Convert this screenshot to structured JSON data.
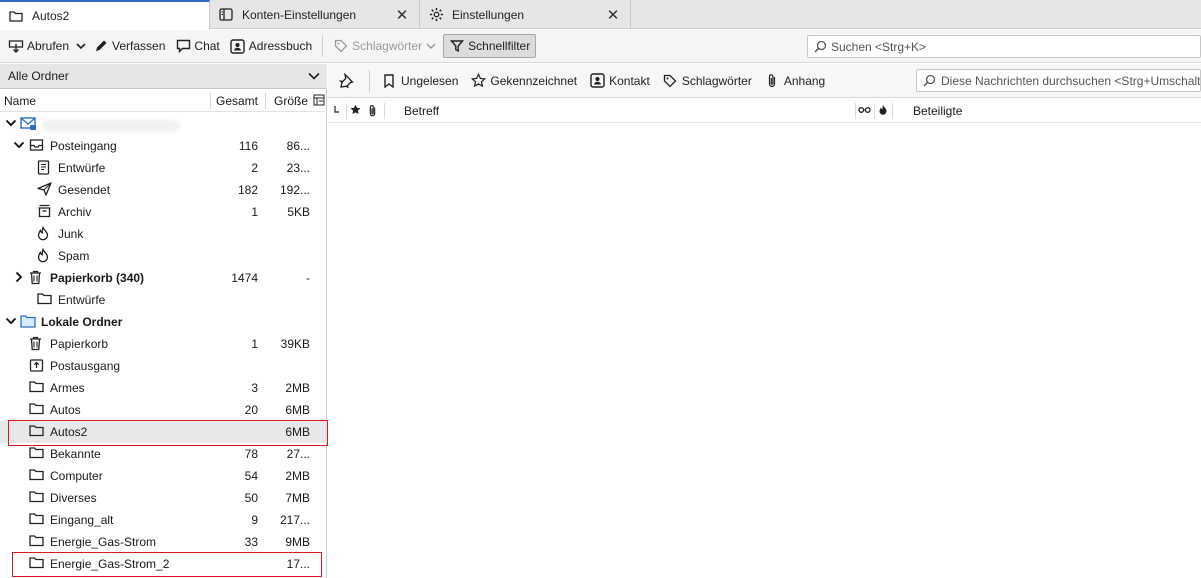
{
  "tabs": [
    {
      "label": "Autos2",
      "icon": "folder-icon",
      "active": true
    },
    {
      "label": "Konten-Einstellungen",
      "icon": "account-settings-icon",
      "active": false
    },
    {
      "label": "Einstellungen",
      "icon": "gear-icon",
      "active": false
    }
  ],
  "toolbar": {
    "abrufen": "Abrufen",
    "verfassen": "Verfassen",
    "chat": "Chat",
    "adressbuch": "Adressbuch",
    "schlagwoerter": "Schlagwörter",
    "schnellfilter": "Schnellfilter",
    "search_placeholder": "Suchen <Strg+K>"
  },
  "folder_pane": {
    "selector_label": "Alle Ordner",
    "columns": {
      "name": "Name",
      "total": "Gesamt",
      "size": "Größe"
    }
  },
  "folders": [
    {
      "name": "",
      "total": "",
      "size": "",
      "level": 0,
      "twisty": "open",
      "icon": "mail-account-icon",
      "bold": false
    },
    {
      "name": "Posteingang",
      "total": "116",
      "size": "86...",
      "level": 1,
      "twisty": "open",
      "icon": "inbox-icon",
      "bold": false
    },
    {
      "name": "Entwürfe",
      "total": "2",
      "size": "23...",
      "level": 2,
      "twisty": "",
      "icon": "drafts-icon",
      "bold": false
    },
    {
      "name": "Gesendet",
      "total": "182",
      "size": "192...",
      "level": 2,
      "twisty": "",
      "icon": "sent-icon",
      "bold": false
    },
    {
      "name": "Archiv",
      "total": "1",
      "size": "5KB",
      "level": 2,
      "twisty": "",
      "icon": "archive-icon",
      "bold": false
    },
    {
      "name": "Junk",
      "total": "",
      "size": "",
      "level": 2,
      "twisty": "",
      "icon": "junk-icon",
      "bold": false
    },
    {
      "name": "Spam",
      "total": "",
      "size": "",
      "level": 2,
      "twisty": "",
      "icon": "junk-icon",
      "bold": false
    },
    {
      "name": "Papierkorb (340)",
      "total": "1474",
      "size": "-",
      "level": 1,
      "twisty": "closed",
      "icon": "trash-icon",
      "bold": true
    },
    {
      "name": "Entwürfe",
      "total": "",
      "size": "",
      "level": 2,
      "twisty": "",
      "icon": "folder-icon",
      "bold": false
    },
    {
      "name": "Lokale Ordner",
      "total": "",
      "size": "",
      "level": 0,
      "twisty": "open",
      "icon": "local-folder-icon",
      "bold": true
    },
    {
      "name": "Papierkorb",
      "total": "1",
      "size": "39KB",
      "level": 1,
      "twisty": "",
      "icon": "trash-icon",
      "bold": false
    },
    {
      "name": "Postausgang",
      "total": "",
      "size": "",
      "level": 1,
      "twisty": "",
      "icon": "outbox-icon",
      "bold": false
    },
    {
      "name": "Armes",
      "total": "3",
      "size": "2MB",
      "level": 1,
      "twisty": "",
      "icon": "folder-icon",
      "bold": false
    },
    {
      "name": "Autos",
      "total": "20",
      "size": "6MB",
      "level": 1,
      "twisty": "",
      "icon": "folder-icon",
      "bold": false
    },
    {
      "name": "Autos2",
      "total": "",
      "size": "6MB",
      "level": 1,
      "twisty": "",
      "icon": "folder-icon",
      "bold": false,
      "selected": true
    },
    {
      "name": "Bekannte",
      "total": "78",
      "size": "27...",
      "level": 1,
      "twisty": "",
      "icon": "folder-icon",
      "bold": false
    },
    {
      "name": "Computer",
      "total": "54",
      "size": "2MB",
      "level": 1,
      "twisty": "",
      "icon": "folder-icon",
      "bold": false
    },
    {
      "name": "Diverses",
      "total": "50",
      "size": "7MB",
      "level": 1,
      "twisty": "",
      "icon": "folder-icon",
      "bold": false
    },
    {
      "name": "Eingang_alt",
      "total": "9",
      "size": "217...",
      "level": 1,
      "twisty": "",
      "icon": "folder-icon",
      "bold": false
    },
    {
      "name": "Energie_Gas-Strom",
      "total": "33",
      "size": "9MB",
      "level": 1,
      "twisty": "",
      "icon": "folder-icon",
      "bold": false
    },
    {
      "name": "Energie_Gas-Strom_2",
      "total": "",
      "size": "17...",
      "level": 1,
      "twisty": "",
      "icon": "folder-icon",
      "bold": false
    }
  ],
  "quickfilter": {
    "ungelesen": "Ungelesen",
    "gekennzeichnet": "Gekennzeichnet",
    "kontakt": "Kontakt",
    "schlagwoerter": "Schlagwörter",
    "anhang": "Anhang",
    "search_placeholder": "Diese Nachrichten durchsuchen <Strg+Umschalt+K>"
  },
  "message_columns": {
    "betreff": "Betreff",
    "beteiligte": "Beteiligte"
  },
  "colors": {
    "accent": "#2f6cc9",
    "highlight_box": "#d81b1b"
  }
}
